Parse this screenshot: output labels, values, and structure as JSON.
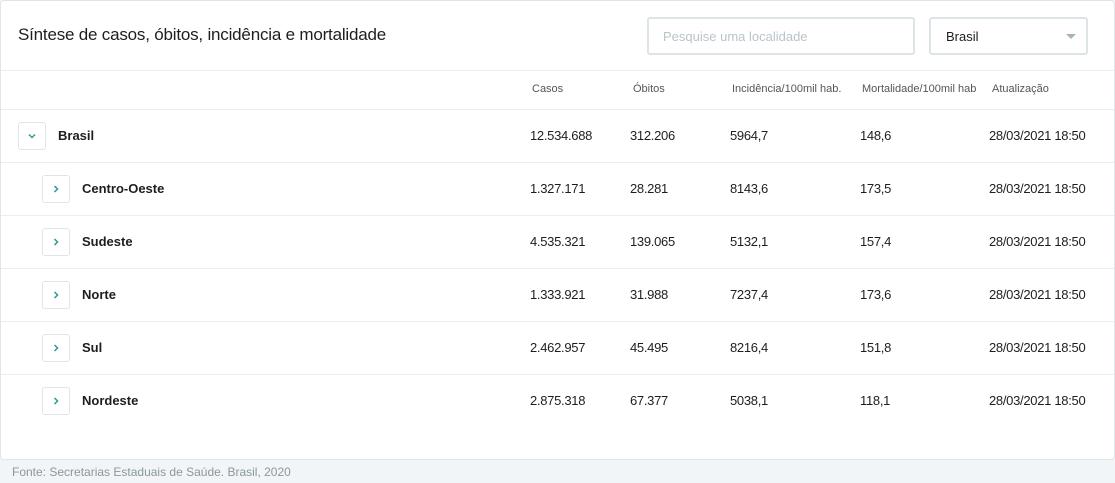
{
  "header": {
    "title": "Síntese de casos, óbitos, incidência e mortalidade",
    "search_placeholder": "Pesquise uma localidade",
    "select_value": "Brasil"
  },
  "columns": {
    "cases": "Casos",
    "deaths": "Óbitos",
    "incidence": "Incidência/100mil hab.",
    "mortality": "Mortalidade/100mil hab",
    "updated": "Atualização"
  },
  "rows": [
    {
      "name": "Brasil",
      "cases": "12.534.688",
      "deaths": "312.206",
      "incidence": "5964,7",
      "mortality": "148,6",
      "updated": "28/03/2021 18:50",
      "expanded": true
    },
    {
      "name": "Centro-Oeste",
      "cases": "1.327.171",
      "deaths": "28.281",
      "incidence": "8143,6",
      "mortality": "173,5",
      "updated": "28/03/2021 18:50",
      "expanded": false
    },
    {
      "name": "Sudeste",
      "cases": "4.535.321",
      "deaths": "139.065",
      "incidence": "5132,1",
      "mortality": "157,4",
      "updated": "28/03/2021 18:50",
      "expanded": false
    },
    {
      "name": "Norte",
      "cases": "1.333.921",
      "deaths": "31.988",
      "incidence": "7237,4",
      "mortality": "173,6",
      "updated": "28/03/2021 18:50",
      "expanded": false
    },
    {
      "name": "Sul",
      "cases": "2.462.957",
      "deaths": "45.495",
      "incidence": "8216,4",
      "mortality": "151,8",
      "updated": "28/03/2021 18:50",
      "expanded": false
    },
    {
      "name": "Nordeste",
      "cases": "2.875.318",
      "deaths": "67.377",
      "incidence": "5038,1",
      "mortality": "118,1",
      "updated": "28/03/2021 18:50",
      "expanded": false
    }
  ],
  "footer": "Fonte: Secretarias Estaduais de Saúde. Brasil, 2020",
  "colors": {
    "accent": "#2a9d8f",
    "border": "#dfe6ea"
  },
  "icons": {
    "expanded": "chevron-down-icon",
    "collapsed": "chevron-right-icon"
  }
}
